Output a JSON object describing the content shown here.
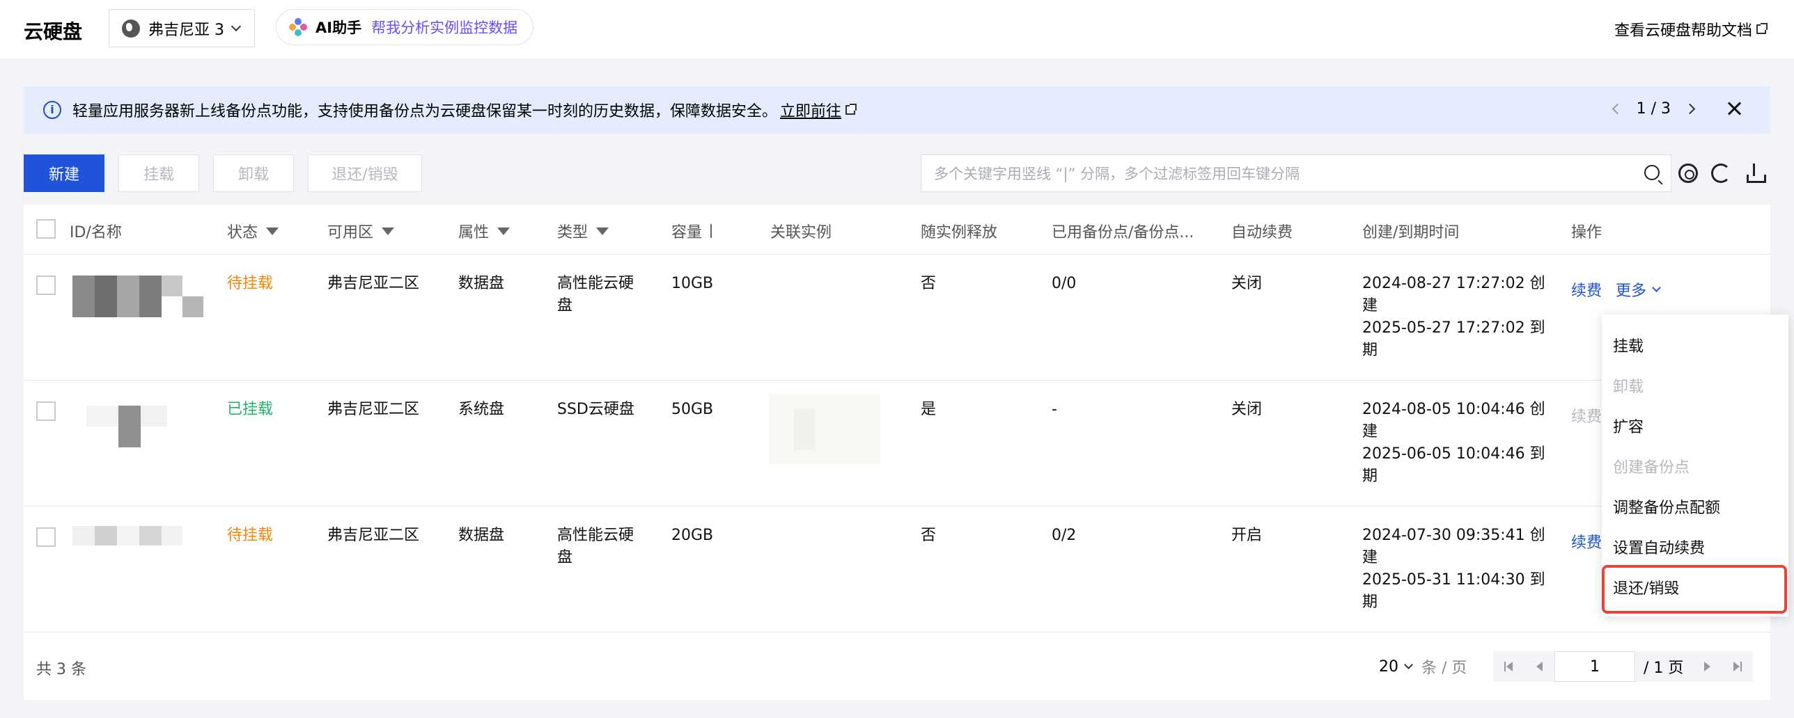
{
  "header": {
    "title": "云硬盘",
    "region": "弗吉尼亚 3",
    "ai_name": "AI助手",
    "ai_prompt": "帮我分析实例监控数据",
    "help_link": "查看云硬盘帮助文档"
  },
  "notice": {
    "text": "轻量应用服务器新上线备份点功能，支持使用备份点为云硬盘保留某一时刻的历史数据，保障数据安全。",
    "link": "立即前往",
    "pager": "1 / 3"
  },
  "toolbar": {
    "new": "新建",
    "mount": "挂载",
    "unmount": "卸载",
    "refund": "退还/销毁",
    "search_placeholder": "多个关键字用竖线 “|” 分隔，多个过滤标签用回车键分隔"
  },
  "table": {
    "headers": {
      "id": "ID/名称",
      "status": "状态",
      "zone": "可用区",
      "attr": "属性",
      "type": "类型",
      "capacity": "容量",
      "instance": "关联实例",
      "release": "随实例释放",
      "backup": "已用备份点/备份点...",
      "renew": "自动续费",
      "time": "创建/到期时间",
      "ops": "操作"
    },
    "rows": [
      {
        "status": "待挂载",
        "zone": "弗吉尼亚二区",
        "attr": "数据盘",
        "type_l1": "高性能云硬",
        "type_l2": "盘",
        "capacity": "10GB",
        "release": "否",
        "backup": "0/0",
        "renew": "关闭",
        "time_l1": "2024-08-27 17:27:02 创",
        "time_l2": "建",
        "time_l3": "2025-05-27 17:27:02 到",
        "time_l4": "期",
        "op_renew": "续费",
        "op_more": "更多"
      },
      {
        "status": "已挂载",
        "zone": "弗吉尼亚二区",
        "attr": "系统盘",
        "type_l1": "SSD云硬盘",
        "type_l2": "",
        "capacity": "50GB",
        "release": "是",
        "backup": "-",
        "renew": "关闭",
        "time_l1": "2024-08-05 10:04:46 创",
        "time_l2": "建",
        "time_l3": "2025-06-05 10:04:46 到",
        "time_l4": "期",
        "op_renew": "续费"
      },
      {
        "status": "待挂载",
        "zone": "弗吉尼亚二区",
        "attr": "数据盘",
        "type_l1": "高性能云硬",
        "type_l2": "盘",
        "capacity": "20GB",
        "release": "否",
        "backup": "0/2",
        "renew": "开启",
        "time_l1": "2024-07-30 09:35:41 创",
        "time_l2": "建",
        "time_l3": "2025-05-31 11:04:30 到",
        "time_l4": "期",
        "op_renew": "续费"
      }
    ],
    "total": "共 3 条",
    "page_size": "20",
    "page_size_unit": "条 / 页",
    "page_input": "1",
    "page_total": "/ 1 页"
  },
  "dropdown": {
    "items": [
      "挂载",
      "卸载",
      "扩容",
      "创建备份点",
      "调整备份点配额",
      "设置自动续费",
      "退还/销毁"
    ]
  },
  "colors": {
    "primary": "#1f53d9",
    "pending": "#f0870c",
    "mounted": "#1fb36a",
    "highlight": "#e0473b",
    "ai": "#6b4cf6"
  }
}
